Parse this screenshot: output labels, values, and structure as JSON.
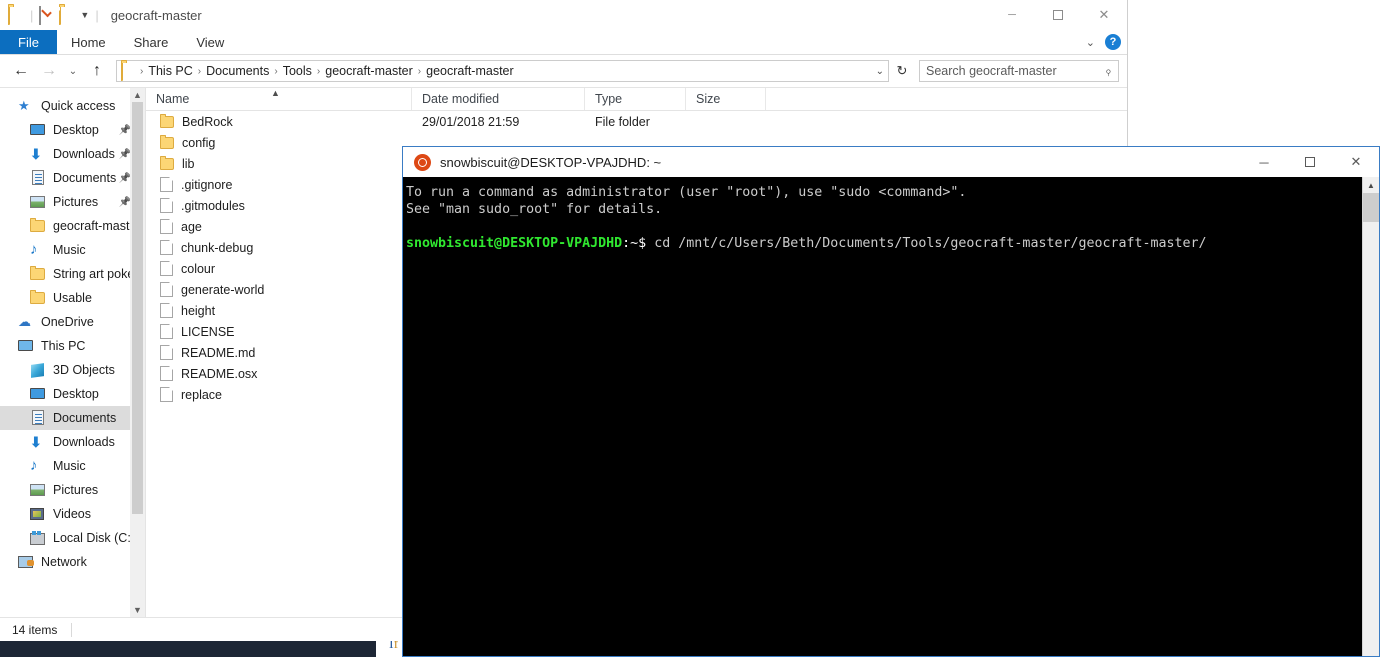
{
  "explorer": {
    "title": "geocraft-master",
    "quick_access_toolbar": {
      "folder_icon": "folder-icon",
      "properties_icon": "properties-icon",
      "new_folder_icon": "new-folder-icon",
      "customize_icon": "chevron-down-icon"
    },
    "window_buttons": {
      "minimize": "─",
      "maximize": "□",
      "close": "✕"
    },
    "ribbon_tabs": [
      {
        "label": "File",
        "active": true
      },
      {
        "label": "Home",
        "active": false
      },
      {
        "label": "Share",
        "active": false
      },
      {
        "label": "View",
        "active": false
      }
    ],
    "ribbon_collapse_icon": "chevron-down-icon",
    "help_label": "?",
    "nav": {
      "back": "←",
      "forward": "→",
      "recent": "⌄",
      "up": "↑",
      "refresh": "↻"
    },
    "breadcrumbs": [
      "This PC",
      "Documents",
      "Tools",
      "geocraft-master",
      "geocraft-master"
    ],
    "breadcrumb_separator": "›",
    "address_dropdown_icon": "chevron-down-icon",
    "search": {
      "placeholder": "Search geocraft-master",
      "icon": "search-icon"
    },
    "sidebar": [
      {
        "label": "Quick access",
        "icon": "star-icon",
        "indent": 0,
        "pinned": false,
        "selected": false
      },
      {
        "label": "Desktop",
        "icon": "monitor-icon",
        "indent": 1,
        "pinned": true,
        "selected": false
      },
      {
        "label": "Downloads",
        "icon": "download-icon",
        "indent": 1,
        "pinned": true,
        "selected": false
      },
      {
        "label": "Documents",
        "icon": "documents-icon",
        "indent": 1,
        "pinned": true,
        "selected": false
      },
      {
        "label": "Pictures",
        "icon": "pictures-icon",
        "indent": 1,
        "pinned": true,
        "selected": false
      },
      {
        "label": "geocraft-master",
        "icon": "folder-icon",
        "indent": 1,
        "pinned": false,
        "selected": false
      },
      {
        "label": "Music",
        "icon": "music-icon",
        "indent": 1,
        "pinned": false,
        "selected": false
      },
      {
        "label": "String art pokem",
        "icon": "folder-icon",
        "indent": 1,
        "pinned": false,
        "selected": false
      },
      {
        "label": "Usable",
        "icon": "folder-icon",
        "indent": 1,
        "pinned": false,
        "selected": false
      },
      {
        "label": "OneDrive",
        "icon": "cloud-icon",
        "indent": 0,
        "pinned": false,
        "selected": false
      },
      {
        "label": "This PC",
        "icon": "pc-icon",
        "indent": 0,
        "pinned": false,
        "selected": false
      },
      {
        "label": "3D Objects",
        "icon": "3d-objects-icon",
        "indent": 1,
        "pinned": false,
        "selected": false
      },
      {
        "label": "Desktop",
        "icon": "monitor-icon",
        "indent": 1,
        "pinned": false,
        "selected": false
      },
      {
        "label": "Documents",
        "icon": "documents-icon",
        "indent": 1,
        "pinned": false,
        "selected": true
      },
      {
        "label": "Downloads",
        "icon": "download-icon",
        "indent": 1,
        "pinned": false,
        "selected": false
      },
      {
        "label": "Music",
        "icon": "music-icon",
        "indent": 1,
        "pinned": false,
        "selected": false
      },
      {
        "label": "Pictures",
        "icon": "pictures-icon",
        "indent": 1,
        "pinned": false,
        "selected": false
      },
      {
        "label": "Videos",
        "icon": "videos-icon",
        "indent": 1,
        "pinned": false,
        "selected": false
      },
      {
        "label": "Local Disk (C:)",
        "icon": "disk-icon",
        "indent": 1,
        "pinned": false,
        "selected": false
      },
      {
        "label": "Network",
        "icon": "network-icon",
        "indent": 0,
        "pinned": false,
        "selected": false
      }
    ],
    "columns": [
      "Name",
      "Date modified",
      "Type",
      "Size"
    ],
    "sort_indicator_icon": "chevron-up-icon",
    "files": [
      {
        "name": "BedRock",
        "icon": "folder-icon",
        "date": "29/01/2018 21:59",
        "type": "File folder",
        "size": ""
      },
      {
        "name": "config",
        "icon": "folder-icon",
        "date": "",
        "type": "",
        "size": ""
      },
      {
        "name": "lib",
        "icon": "folder-icon",
        "date": "",
        "type": "",
        "size": ""
      },
      {
        "name": ".gitignore",
        "icon": "file-icon",
        "date": "",
        "type": "",
        "size": ""
      },
      {
        "name": ".gitmodules",
        "icon": "file-icon",
        "date": "",
        "type": "",
        "size": ""
      },
      {
        "name": "age",
        "icon": "file-icon",
        "date": "",
        "type": "",
        "size": ""
      },
      {
        "name": "chunk-debug",
        "icon": "file-icon",
        "date": "",
        "type": "",
        "size": ""
      },
      {
        "name": "colour",
        "icon": "file-icon",
        "date": "",
        "type": "",
        "size": ""
      },
      {
        "name": "generate-world",
        "icon": "file-icon",
        "date": "",
        "type": "",
        "size": ""
      },
      {
        "name": "height",
        "icon": "file-icon",
        "date": "",
        "type": "",
        "size": ""
      },
      {
        "name": "LICENSE",
        "icon": "file-icon",
        "date": "",
        "type": "",
        "size": ""
      },
      {
        "name": "README.md",
        "icon": "file-icon",
        "date": "",
        "type": "",
        "size": ""
      },
      {
        "name": "README.osx",
        "icon": "file-icon",
        "date": "",
        "type": "",
        "size": ""
      },
      {
        "name": "replace",
        "icon": "file-icon",
        "date": "",
        "type": "",
        "size": ""
      }
    ],
    "status": "14 items"
  },
  "terminal": {
    "title": "snowbiscuit@DESKTOP-VPAJDHD: ~",
    "icon": "ubuntu-icon",
    "window_buttons": {
      "minimize": "─",
      "maximize": "□",
      "close": "✕"
    },
    "lines": [
      {
        "type": "plain",
        "text": "To run a command as administrator (user \"root\"), use \"sudo <command>\"."
      },
      {
        "type": "plain",
        "text": "See \"man sudo_root\" for details."
      },
      {
        "type": "plain",
        "text": ""
      },
      {
        "type": "prompt",
        "user": "snowbiscuit@DESKTOP-VPAJDHD",
        "punc": ":~$ ",
        "command": "cd /mnt/c/Users/Beth/Documents/Tools/geocraft-master/geocraft-master/"
      }
    ],
    "scrollbar_up_icon": "chevron-up-icon"
  },
  "background": {
    "partial_window_text_blue": "I",
    "partial_window_text_amber": "f"
  },
  "colors": {
    "accent_blue": "#0c6ebf",
    "terminal_bg": "#000000",
    "terminal_green": "#30e830",
    "terminal_fg": "#cccccc",
    "folder_yellow": "#fcd675",
    "selection_gray": "#dcdcdc",
    "taskbar_navy": "#1d2635"
  }
}
